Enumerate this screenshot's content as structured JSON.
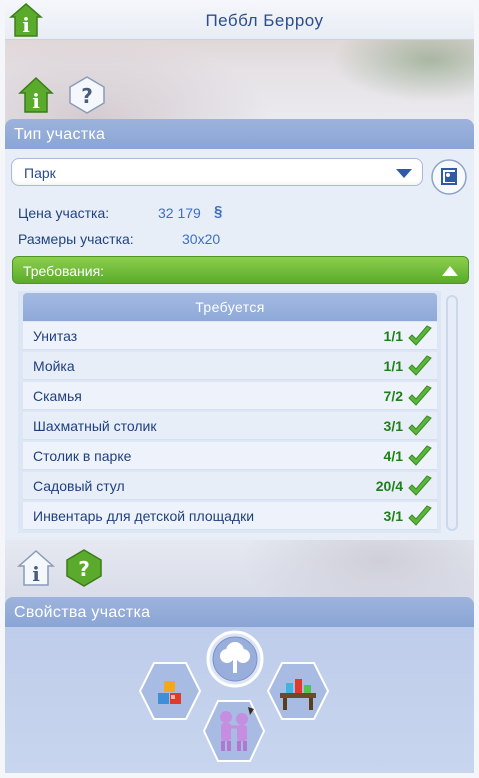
{
  "header": {
    "title": "Пеббл Берроу"
  },
  "lot_type": {
    "section_title": "Тип участка",
    "selected_type": "Парк",
    "price_label": "Цена участка:",
    "price_value": "32 179",
    "currency_symbol": "§",
    "size_label": "Размеры участка:",
    "size_value": "30x20"
  },
  "requirements": {
    "title": "Требования:",
    "list_header": "Требуется",
    "items": [
      {
        "name": "Унитаз",
        "count": "1/1"
      },
      {
        "name": "Мойка",
        "count": "1/1"
      },
      {
        "name": "Скамья",
        "count": "7/2"
      },
      {
        "name": "Шахматный столик",
        "count": "3/1"
      },
      {
        "name": "Столик в парке",
        "count": "4/1"
      },
      {
        "name": "Садовый стул",
        "count": "20/4"
      },
      {
        "name": "Инвентарь для детской площадки",
        "count": "3/1"
      }
    ]
  },
  "lot_traits": {
    "section_title": "Свойства участка",
    "icons": [
      "tree-icon",
      "toy-blocks-icon",
      "chemistry-table-icon",
      "kids-playing-icon"
    ]
  },
  "colors": {
    "accent_blue": "#8aa5d5",
    "requirement_green": "#5aab2b",
    "title_blue": "#2c4e8c"
  }
}
